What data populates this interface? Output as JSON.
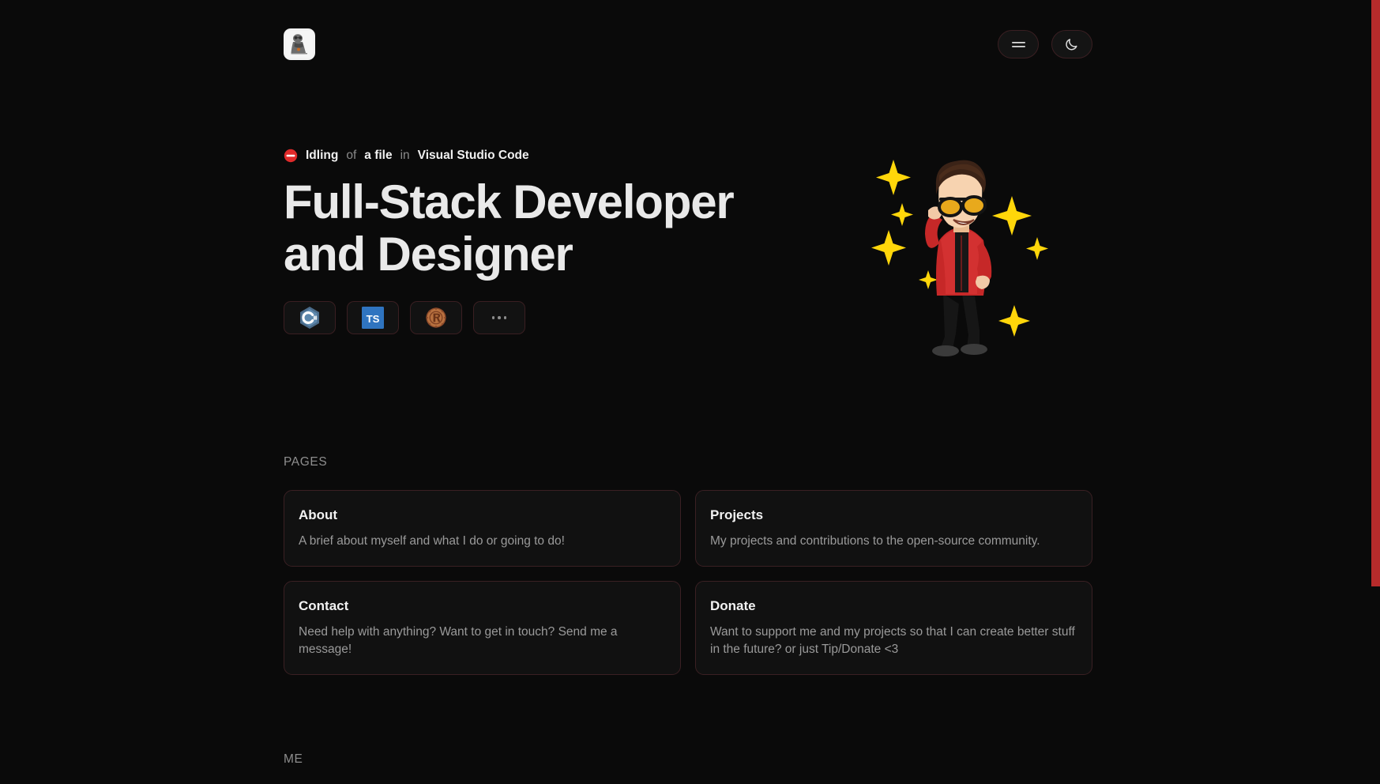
{
  "theme": {
    "background": "#0a0a0a",
    "card_background": "#111111",
    "card_border": "#3a2023",
    "accent_red": "#b62b2b",
    "text_primary": "#e9e9e9",
    "text_muted": "#9a9a9a"
  },
  "header": {
    "logo_name": "site-logo",
    "menu_button_label": "Menu",
    "theme_toggle_label": "Dark mode",
    "icons": {
      "menu": "hamburger-menu-icon",
      "theme": "moon-icon"
    }
  },
  "hero": {
    "status": {
      "icon": "do-not-disturb-icon",
      "activity": "Idling",
      "connector_of": "of",
      "target": "a file",
      "connector_in": "in",
      "app": "Visual Studio Code"
    },
    "title": "Full-Stack Developer and Designer",
    "tech": [
      {
        "name": "csharp-icon",
        "label": "C#"
      },
      {
        "name": "typescript-icon",
        "label": "TS"
      },
      {
        "name": "rust-icon",
        "label": "Rust"
      },
      {
        "name": "more-icon",
        "label": "..."
      }
    ],
    "avatar_alt": "Avatar illustration of person in red jacket with yellow sunglasses and sparkles"
  },
  "sections": [
    {
      "label": "PAGES",
      "cards": [
        {
          "title": "About",
          "desc": "A brief about myself and what I do or going to do!"
        },
        {
          "title": "Projects",
          "desc": "My projects and contributions to the open-source community."
        },
        {
          "title": "Contact",
          "desc": "Need help with anything? Want to get in touch? Send me a message!"
        },
        {
          "title": "Donate",
          "desc": "Want to support me and my projects so that I can create better stuff in the future? or just Tip/Donate <3"
        }
      ]
    },
    {
      "label": "ME",
      "cards": []
    }
  ]
}
